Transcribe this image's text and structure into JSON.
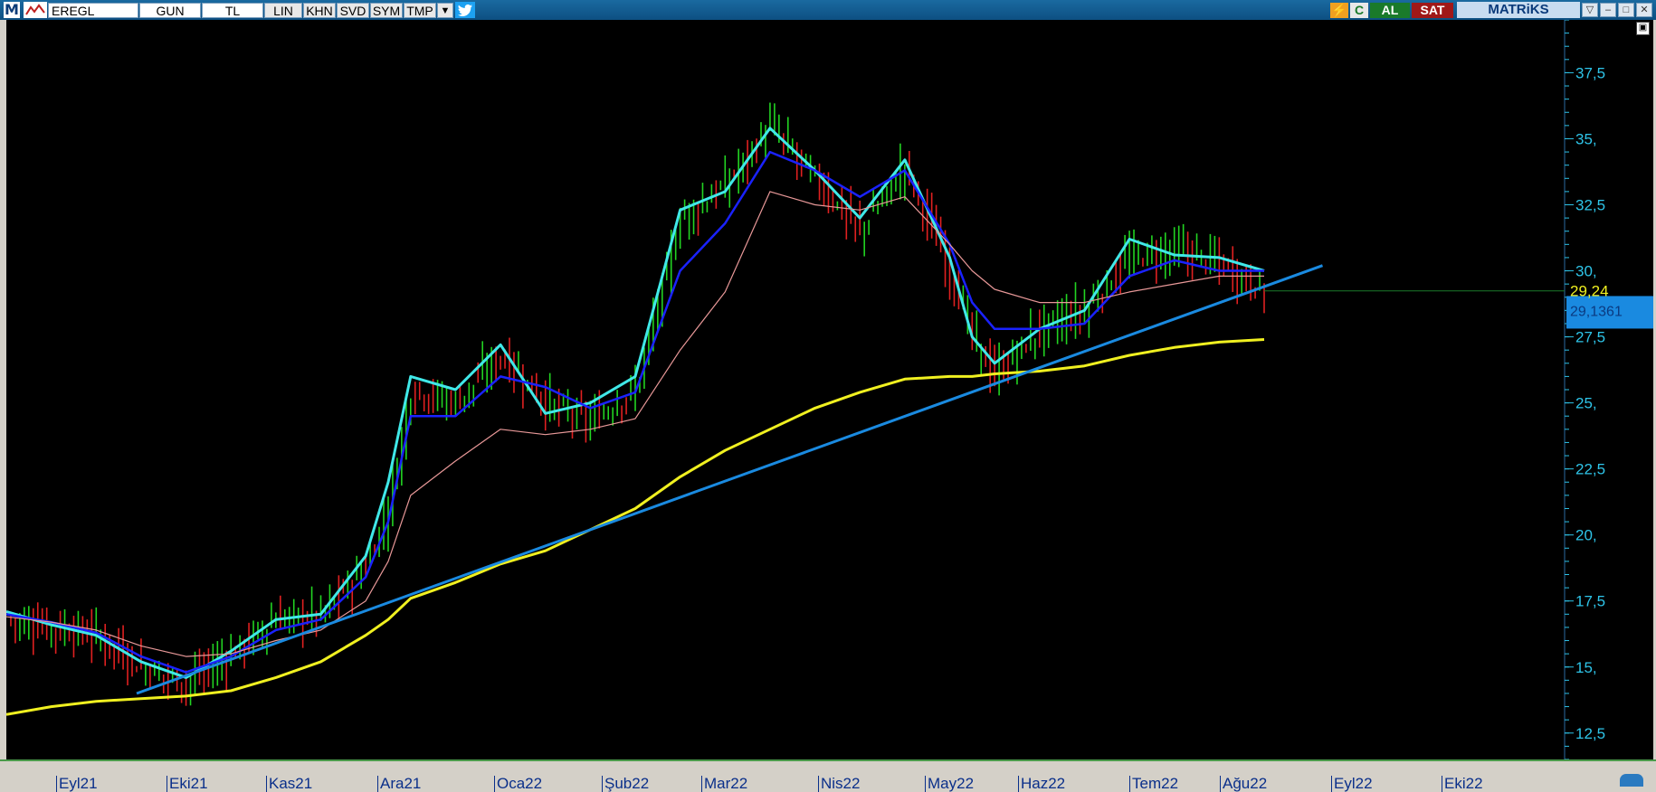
{
  "toolbar": {
    "logo": "M",
    "symbol": "EREGL",
    "period": "GUN",
    "currency": "TL",
    "buttons": [
      "LIN",
      "KHN",
      "SVD",
      "SYM",
      "TMP"
    ],
    "dropdown_icon": "triangle-down-icon",
    "share_icon": "twitter-icon",
    "refresh_label": "C",
    "buy_label": "AL",
    "sell_label": "SAT",
    "brand": "MATRiKS",
    "colors": {
      "bar": "#0d4f82",
      "buy_bg": "#1a7a2a",
      "sell_bg": "#a01818"
    }
  },
  "price_tags": {
    "last_price": "29,24",
    "trend_value": "29,1361"
  },
  "chart_data": {
    "type": "line",
    "symbol": "EREGL",
    "x_tick_labels": [
      "Eyl21",
      "Eki21",
      "Kas21",
      "Ara21",
      "Oca22",
      "Şub22",
      "Mar22",
      "Nis22",
      "May22",
      "Haz22",
      "Tem22",
      "Ağu22",
      "Eyl22",
      "Eki22"
    ],
    "y_tick_labels": [
      "37,5",
      "35,",
      "32,5",
      "30,",
      "27,5",
      "25,",
      "22,5",
      "20,",
      "17,5",
      "15,",
      "12,5"
    ],
    "ylim": [
      11.5,
      39.5
    ],
    "x_axis": {
      "unit": "trading day",
      "range": [
        0,
        280
      ]
    },
    "background": "#000000",
    "grid": false,
    "last_price": 29.24,
    "series": [
      {
        "style": "candlestick-ohlc",
        "color_up": "#22d422",
        "color_down": "#e02020",
        "x": [
          0,
          10,
          20,
          30,
          40,
          50,
          60,
          70,
          80,
          85,
          90,
          100,
          110,
          120,
          130,
          140,
          150,
          160,
          170,
          180,
          190,
          200,
          210,
          215,
          220,
          230,
          240,
          250,
          260,
          270,
          280
        ],
        "values": [
          16.8,
          16.5,
          16.2,
          15.0,
          14.4,
          15.5,
          16.8,
          17.0,
          18.8,
          21.0,
          25.5,
          25.0,
          26.8,
          25.0,
          24.3,
          25.5,
          32.0,
          33.2,
          35.5,
          33.5,
          31.5,
          34.0,
          30.0,
          27.5,
          26.0,
          27.8,
          28.5,
          30.5,
          30.8,
          30.3,
          29.2
        ]
      },
      {
        "color": "#40e8e8",
        "x": [
          0,
          10,
          20,
          30,
          40,
          50,
          60,
          70,
          80,
          85,
          90,
          100,
          110,
          120,
          130,
          140,
          150,
          160,
          170,
          180,
          190,
          200,
          210,
          215,
          220,
          230,
          240,
          250,
          260,
          270,
          280
        ],
        "values": [
          17.1,
          16.6,
          16.2,
          15.2,
          14.6,
          15.6,
          16.8,
          17.0,
          19.2,
          22.0,
          26.0,
          25.5,
          27.2,
          24.6,
          25.0,
          26.0,
          32.3,
          33.0,
          35.4,
          33.8,
          32.0,
          34.2,
          30.5,
          27.5,
          26.5,
          27.8,
          28.5,
          31.2,
          30.6,
          30.5,
          30.0
        ]
      },
      {
        "color": "#1a22ff",
        "x": [
          0,
          10,
          20,
          30,
          40,
          50,
          60,
          70,
          80,
          85,
          90,
          100,
          110,
          120,
          130,
          140,
          150,
          160,
          170,
          180,
          190,
          200,
          210,
          215,
          220,
          230,
          240,
          250,
          260,
          270,
          280
        ],
        "values": [
          17.0,
          16.7,
          16.3,
          15.4,
          14.8,
          15.4,
          16.4,
          16.8,
          18.4,
          20.5,
          24.5,
          24.5,
          26.0,
          25.6,
          24.8,
          25.4,
          30.0,
          31.8,
          34.5,
          33.8,
          32.8,
          33.8,
          31.0,
          28.8,
          27.8,
          27.8,
          28.0,
          29.8,
          30.4,
          30.0,
          30.0
        ]
      },
      {
        "color": "#e89898",
        "x": [
          0,
          10,
          20,
          30,
          40,
          50,
          60,
          70,
          80,
          85,
          90,
          100,
          110,
          120,
          130,
          140,
          150,
          160,
          170,
          180,
          190,
          200,
          210,
          215,
          220,
          230,
          240,
          250,
          260,
          270,
          280
        ],
        "values": [
          16.9,
          16.7,
          16.4,
          15.8,
          15.4,
          15.5,
          16.0,
          16.4,
          17.5,
          19.0,
          21.5,
          22.8,
          24.0,
          23.8,
          24.0,
          24.4,
          27.0,
          29.2,
          33.0,
          32.5,
          32.3,
          32.8,
          31.0,
          30.0,
          29.3,
          28.8,
          28.8,
          29.2,
          29.5,
          29.8,
          29.8
        ]
      },
      {
        "color": "#f0f020",
        "x": [
          0,
          10,
          20,
          30,
          40,
          50,
          60,
          70,
          80,
          85,
          90,
          100,
          110,
          120,
          130,
          140,
          150,
          160,
          170,
          180,
          190,
          200,
          210,
          215,
          220,
          230,
          240,
          250,
          260,
          270,
          280
        ],
        "values": [
          13.2,
          13.5,
          13.7,
          13.8,
          13.9,
          14.1,
          14.6,
          15.2,
          16.2,
          16.8,
          17.6,
          18.2,
          18.9,
          19.4,
          20.2,
          21.0,
          22.2,
          23.2,
          24.0,
          24.8,
          25.4,
          25.9,
          26.0,
          26.0,
          26.1,
          26.2,
          26.4,
          26.8,
          27.1,
          27.3,
          27.4
        ]
      },
      {
        "color": "#1a8ae0",
        "x": [
          29,
          293
        ],
        "values": [
          14.0,
          30.2
        ]
      }
    ],
    "annotations": [
      {
        "text": "29,24",
        "y": 29.24,
        "color": "#f0f020"
      },
      {
        "text": "29,1361",
        "y": 28.6,
        "color": "#1a8ae0"
      }
    ]
  }
}
